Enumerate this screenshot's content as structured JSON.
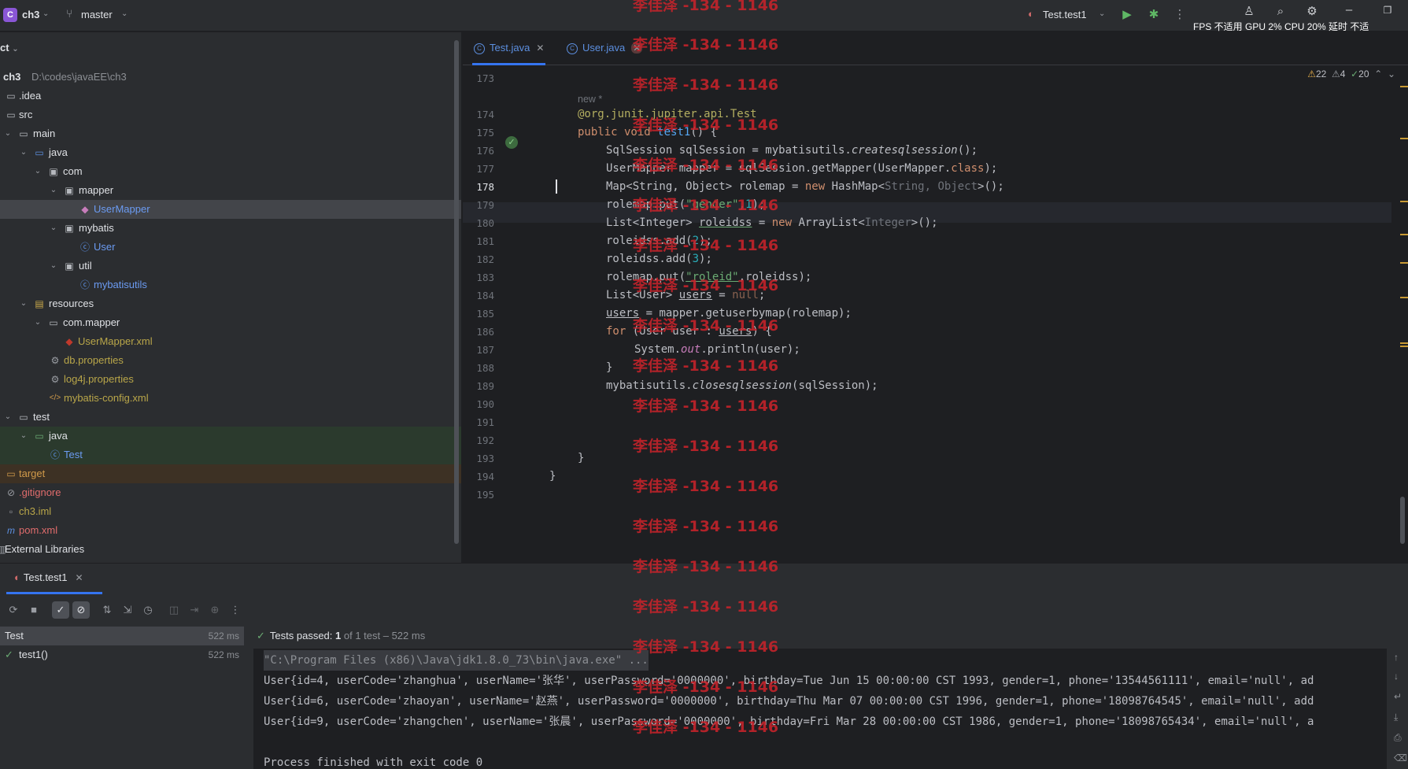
{
  "titlebar": {
    "project_badge": "C",
    "project_name": "ch3",
    "branch": "master",
    "run_config": "Test.test1",
    "hud": "FPS 不适用 GPU  2%  CPU  20% 延时 不适"
  },
  "project": {
    "header": "ct",
    "tree": [
      {
        "label": "ch3",
        "path": "D:\\codes\\javaEE\\ch3"
      },
      {
        "label": ".idea"
      },
      {
        "label": "src"
      },
      {
        "label": "main"
      },
      {
        "label": "java"
      },
      {
        "label": "com"
      },
      {
        "label": "mapper"
      },
      {
        "label": "UserMapper"
      },
      {
        "label": "mybatis"
      },
      {
        "label": "User"
      },
      {
        "label": "util"
      },
      {
        "label": "mybatisutils"
      },
      {
        "label": "resources"
      },
      {
        "label": "com.mapper"
      },
      {
        "label": "UserMapper.xml"
      },
      {
        "label": "db.properties"
      },
      {
        "label": "log4j.properties"
      },
      {
        "label": "mybatis-config.xml"
      },
      {
        "label": "test"
      },
      {
        "label": "java"
      },
      {
        "label": "Test"
      },
      {
        "label": "target"
      },
      {
        "label": ".gitignore"
      },
      {
        "label": "ch3.iml"
      },
      {
        "label": "pom.xml"
      },
      {
        "label": "External Libraries"
      }
    ]
  },
  "editor": {
    "tabs": [
      {
        "label": "Test.java",
        "active": true
      },
      {
        "label": "User.java",
        "active": false
      }
    ],
    "inspections": {
      "warnings": "22",
      "weak_warnings": "4",
      "typos": "20"
    },
    "line_numbers": [
      "173",
      "174",
      "175",
      "176",
      "177",
      "178",
      "179",
      "180",
      "181",
      "182",
      "183",
      "184",
      "185",
      "186",
      "187",
      "188",
      "189",
      "190",
      "191",
      "192",
      "193",
      "194",
      "195"
    ],
    "current_line": "178",
    "inlay_hint": "new *",
    "code": {
      "l174": "@org.junit.jupiter.api.Test",
      "l175_kw": "public void ",
      "l175_fn": "test1",
      "l175_rest": "() {",
      "l176_a": "SqlSession sqlSession = mybatisutils.",
      "l176_b": "createsqlsession",
      "l176_c": "();",
      "l177_a": "UserMapper mapper = sqlSession.getMapper(UserMapper.",
      "l177_b": "class",
      "l177_c": ");",
      "l178_a": "Map<String, Object> rolemap = ",
      "l178_b": "new",
      "l178_c": " HashMap<",
      "l178_d": "String, Object",
      "l178_e": ">();",
      "l179_a": "rolemap.put(",
      "l179_b": "\"gender\"",
      "l179_c": ",",
      "l179_d": "1",
      "l179_e": ");",
      "l180_a": "List<Integer> ",
      "l180_b": "roleidss",
      "l180_c": " = ",
      "l180_d": "new",
      "l180_e": " ArrayList<",
      "l180_f": "Integer",
      "l180_g": ">();",
      "l181_a": "roleidss.add(",
      "l181_b": "2",
      "l181_c": ");",
      "l182_a": "roleidss.add(",
      "l182_b": "3",
      "l182_c": ");",
      "l183_a": "rolemap.put(",
      "l183_b": "\"roleid\"",
      "l183_c": ",roleidss);",
      "l184_a": "List<User> ",
      "l184_b": "users",
      "l184_c": " = ",
      "l184_d": "null",
      "l184_e": ";",
      "l185_a": "users",
      "l185_b": " = mapper.getuserbymap(rolemap);",
      "l186_a": "for",
      "l186_b": " (User user : ",
      "l186_c": "users",
      "l186_d": ") {",
      "l187_a": "System.",
      "l187_b": "out",
      "l187_c": ".println(user);",
      "l188": "}",
      "l189_a": "mybatisutils.",
      "l189_b": "closesqlsession",
      "l189_c": "(sqlSession);",
      "l193": "}",
      "l194": "}"
    }
  },
  "run": {
    "tab_label": "Test.test1",
    "status_passed": "Tests passed: ",
    "status_count": "1",
    "status_rest": " of 1 test – 522 ms",
    "tests": [
      {
        "name": "Test",
        "duration": "522 ms"
      },
      {
        "name": "test1()",
        "duration": "522 ms"
      }
    ],
    "console": [
      "\"C:\\Program Files (x86)\\Java\\jdk1.8.0_73\\bin\\java.exe\" ...",
      "User{id=4, userCode='zhanghua', userName='张华', userPassword='0000000', birthday=Tue Jun 15 00:00:00 CST 1993, gender=1, phone='13544561111', email='null', ad",
      "User{id=6, userCode='zhaoyan', userName='赵燕', userPassword='0000000', birthday=Thu Mar 07 00:00:00 CST 1996, gender=1, phone='18098764545', email='null', add",
      "User{id=9, userCode='zhangchen', userName='张晨', userPassword='0000000', birthday=Fri Mar 28 00:00:00 CST 1986, gender=1, phone='18098765434', email='null', a",
      "",
      "Process finished with exit code 0"
    ]
  },
  "watermark": "李佳泽 -134 - 1146"
}
